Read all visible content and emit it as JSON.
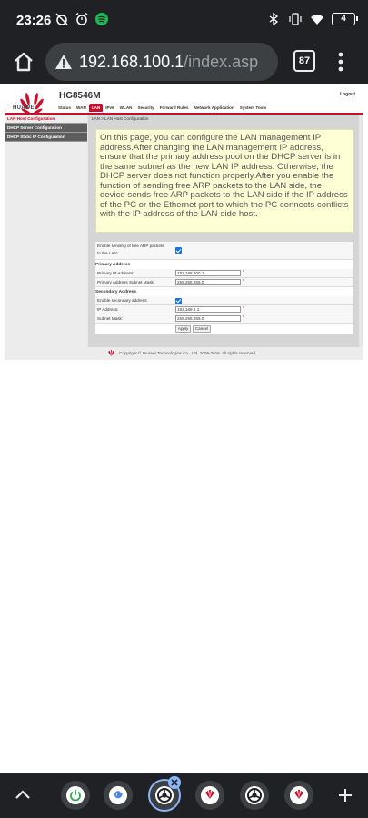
{
  "status_bar": {
    "time": "23:26",
    "battery": "4",
    "icons": [
      "alarm-off-icon",
      "alarm-icon",
      "spotify-icon",
      "bluetooth-icon",
      "vibrate-icon",
      "wifi-icon",
      "battery-icon"
    ]
  },
  "browser": {
    "url_host": "192.168.100.1",
    "url_path": "/index.asp",
    "tab_count": "87"
  },
  "router": {
    "brand": "HUAWEI",
    "model": "HG8546M",
    "logout_label": "Logout",
    "nav": [
      "Status",
      "WAN",
      "LAN",
      "IPv6",
      "WLAN",
      "Security",
      "Forward Rules",
      "Network Application",
      "System Tools"
    ],
    "nav_active": "LAN",
    "sidebar": [
      "LAN Host Configuration",
      "DHCP Server Configuration",
      "DHCP Static IP Configuration"
    ],
    "breadcrumb": "LAN > LAN Host Configuration",
    "info": "On this page, you can configure the LAN management IP address.After changing the LAN management IP address, ensure that the primary address pool on the DHCP server is in the same subnet as the new LAN IP address. Otherwise, the DHCP server does not function properly.After you enable the function of sending free ARP packets to the LAN side, the device sends free ARP packets to the LAN side if the IP address of the PC or the Ethernet port to which the PC connects conflicts with the IP address of the LAN-side host.",
    "form": {
      "arp_label_1": "Enable sending of free ARP packets",
      "arp_label_2": "to the LAN:",
      "primary_title": "Primary Address",
      "primary_ip_label": "Primary IP Address:",
      "primary_ip_value": "192.168.100.1",
      "primary_mask_label": "Primary Address Subnet Mask:",
      "primary_mask_value": "255.255.255.0",
      "secondary_title": "Secondary Address",
      "secondary_enable_label": "Enable secondary address:",
      "secondary_ip_label": "IP Address:",
      "secondary_ip_value": "192.168.2.1",
      "secondary_mask_label": "Subnet Mask:",
      "secondary_mask_value": "255.255.255.0",
      "required_mark": "*",
      "apply_label": "Apply",
      "cancel_label": "Cancel"
    },
    "copyright": "Copyright © Huawei Technologies Co., Ltd. 2009-2016. All rights reserved."
  },
  "colors": {
    "huawei_red": "#c8102e",
    "chrome_dark": "#202124",
    "info_bg": "#ffffd6"
  }
}
